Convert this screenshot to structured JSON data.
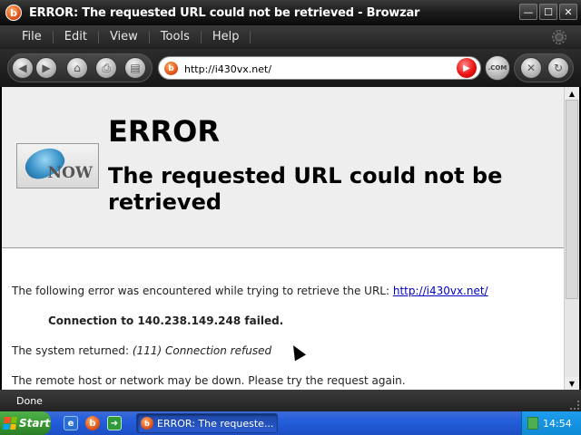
{
  "window": {
    "title": "ERROR: The requested URL could not be retrieved - Browzar",
    "app_icon_letter": "b",
    "minimize": "—",
    "maximize": "☐",
    "close": "✕"
  },
  "menu": {
    "items": [
      "File",
      "Edit",
      "View",
      "Tools",
      "Help"
    ]
  },
  "toolbar": {
    "back_icon": "◀",
    "forward_icon": "▶",
    "home_icon": "⌂",
    "print_icon": "⎙",
    "other_icon": "▤",
    "address": "http://i430vx.net/",
    "go_icon": "▶",
    "com_label": ".COM",
    "stop_icon": "✕",
    "refresh_icon": "↻"
  },
  "page": {
    "logo_text": "NOW",
    "heading": "ERROR",
    "subheading": "The requested URL could not be retrieved",
    "p1_text": "The following error was encountered while trying to retrieve the URL: ",
    "p1_link": "http://i430vx.net/",
    "p2": "Connection to 140.238.149.248 failed.",
    "p3_text": "The system returned: ",
    "p3_italic": "(111) Connection refused",
    "p4": "The remote host or network may be down. Please try the request again."
  },
  "status": {
    "text": "Done"
  },
  "taskbar": {
    "start_label": "Start",
    "task_label": "ERROR: The requeste...",
    "clock": "14:54"
  },
  "colors": {
    "link": "#0000cc",
    "taskbar": "#245edb",
    "start": "#3a9a34",
    "chrome_dark": "#1a1a1a"
  }
}
